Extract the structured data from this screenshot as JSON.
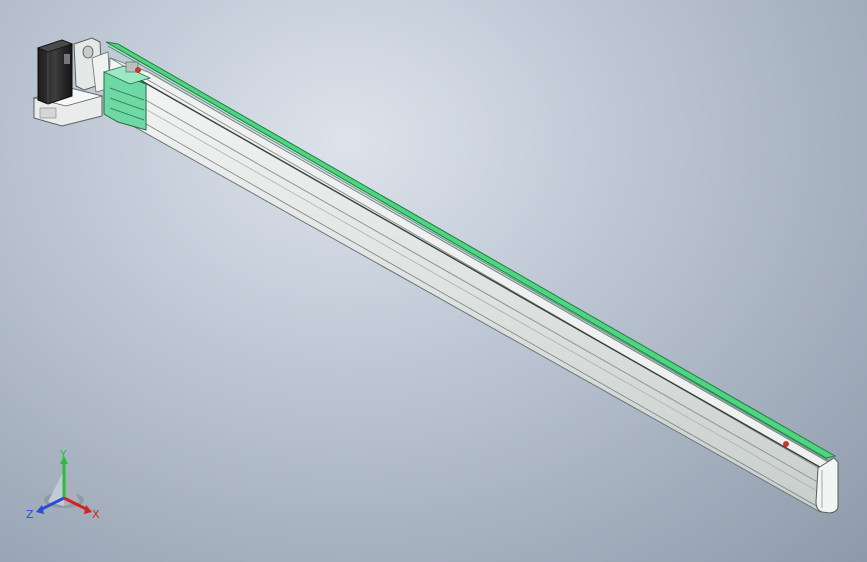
{
  "viewport": {
    "background_top": "#dde3ec",
    "background_bottom": "#8e9aaa"
  },
  "model": {
    "parts": [
      "stepper-motor",
      "motor-mount",
      "end-plate",
      "carriage",
      "rail-body",
      "guide-rail",
      "end-cap"
    ],
    "colors": {
      "rail_body": "#dfe4e2",
      "guide_rail": "#4fd47f",
      "motor": "#2b2b2b",
      "carriage": "#6fd8a4",
      "limit_marker": "#c0392b"
    }
  },
  "triad": {
    "x_label": "X",
    "y_label": "Y",
    "z_label": "Z",
    "x_color": "#d22323",
    "y_color": "#22c23a",
    "z_color": "#2a4fd6"
  }
}
